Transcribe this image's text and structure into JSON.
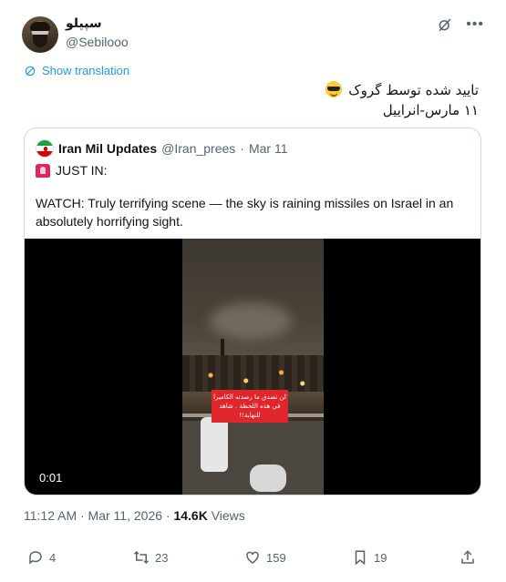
{
  "author": {
    "display_name": "سپیلو",
    "handle": "@Sebilooo"
  },
  "show_translation": "Show translation",
  "tweet_text": {
    "line1": "تایید شده توسط گروک",
    "line2": "۱۱ مارس-انراییل"
  },
  "quoted": {
    "name": "Iran Mil Updates",
    "handle": "@Iran_prees",
    "dot": "·",
    "date": "Mar 11",
    "line1": "JUST IN:",
    "body": "WATCH: Truly terrifying scene — the sky is raining missiles on Israel in an absolutely horrifying sight.",
    "video": {
      "caption": "لن تصدق ما رصدته الكاميرا في هذه اللحظة . شاهد للنهاية!!",
      "timestamp": "0:01"
    }
  },
  "meta": {
    "time": "11:12 AM · Mar 11, 2026 · ",
    "views_count": "14.6K",
    "views_label": " Views"
  },
  "actions": {
    "replies": "4",
    "reposts": "23",
    "likes": "159",
    "bookmarks": "19"
  },
  "colors": {
    "accent": "#1d9bf0",
    "text": "#0f1419",
    "muted": "#536471",
    "border": "#cfd9de"
  },
  "icons": [
    "grok-icon",
    "more-icon",
    "translate-icon",
    "sunglasses-emoji",
    "iran-flag-icon",
    "siren-icon",
    "reply-icon",
    "repost-icon",
    "like-icon",
    "bookmark-icon",
    "share-icon"
  ]
}
